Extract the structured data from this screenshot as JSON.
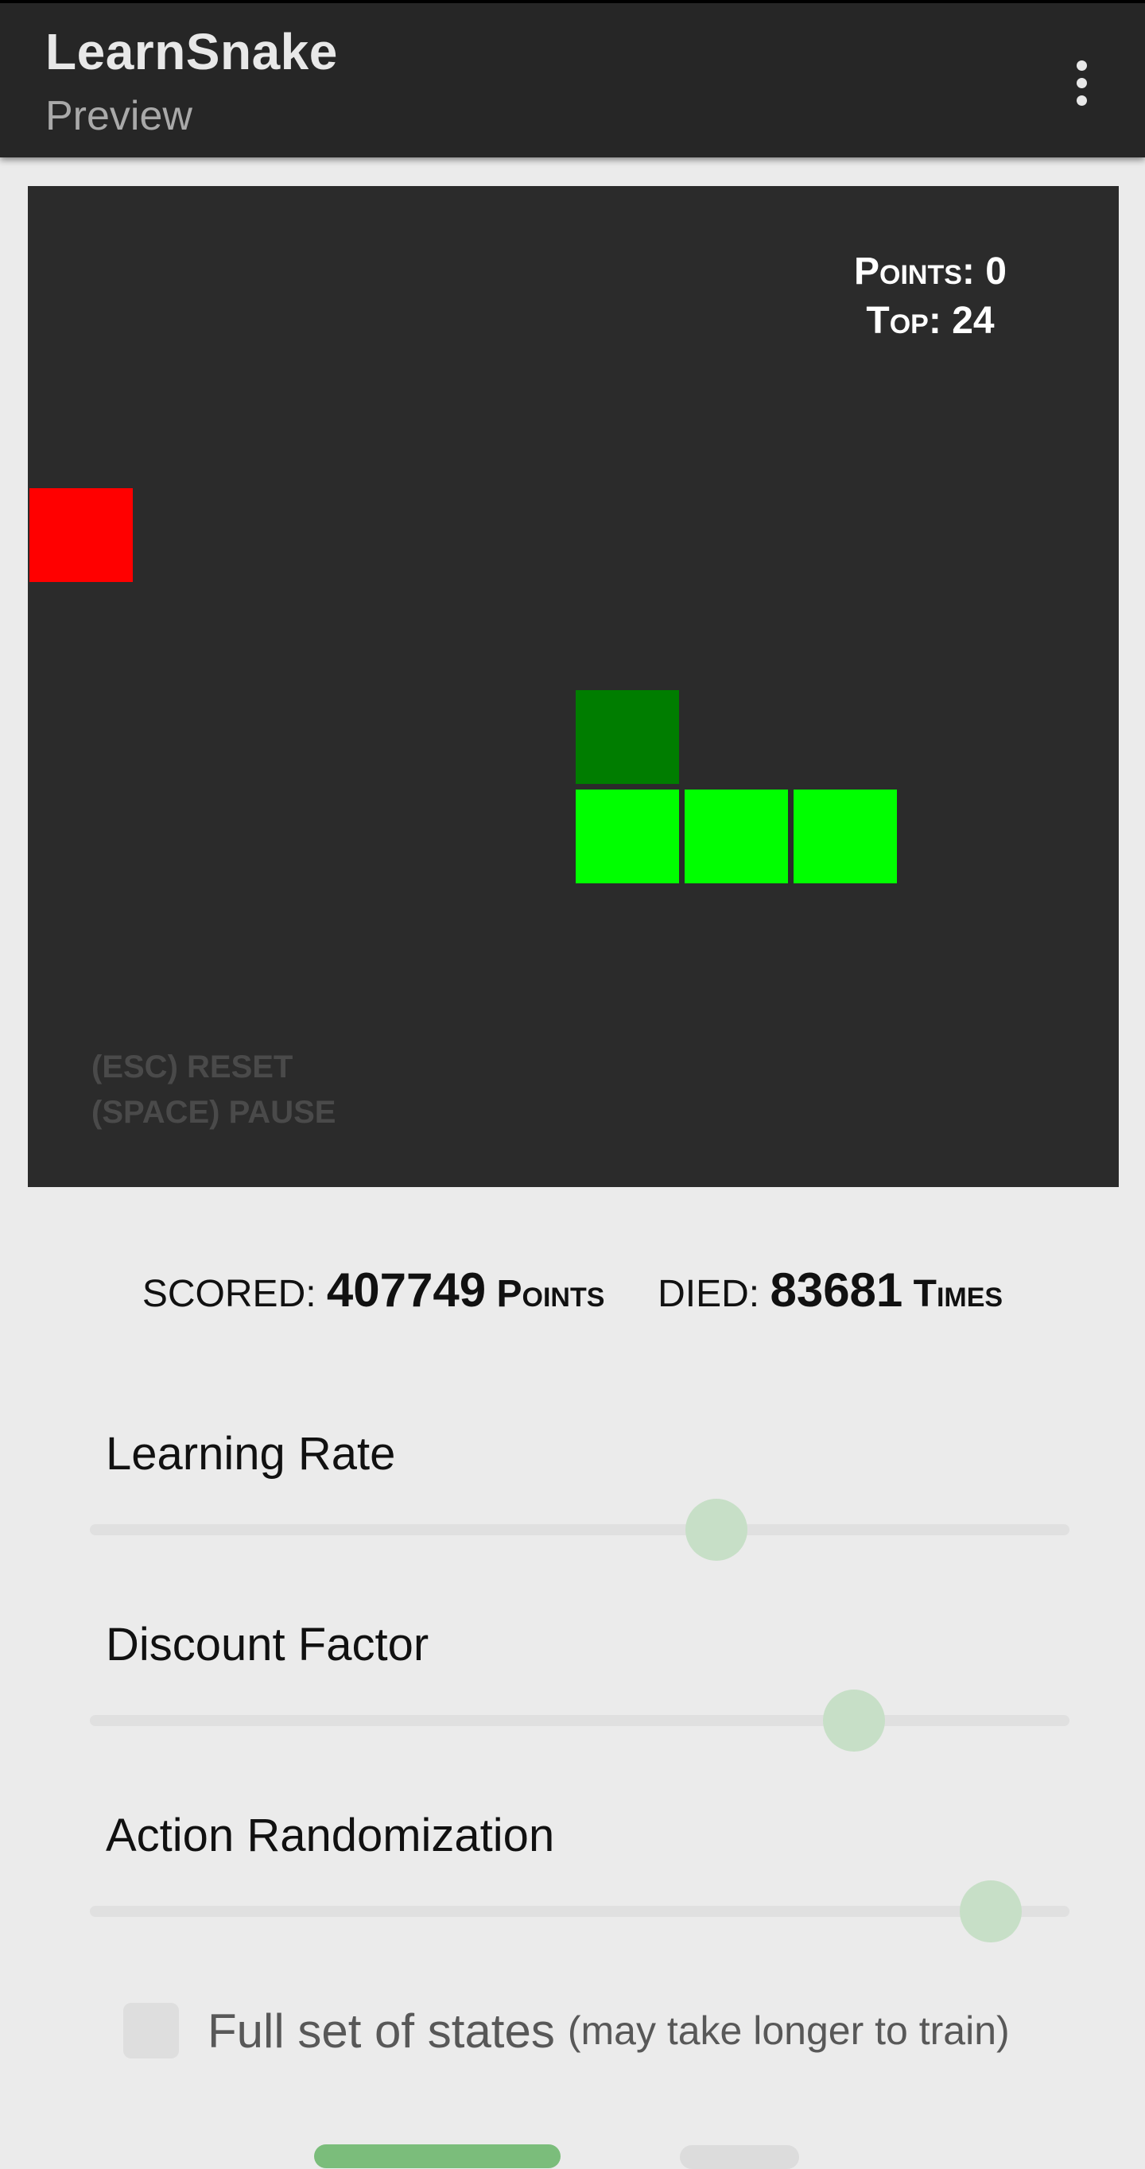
{
  "app": {
    "title": "LearnSnake",
    "subtitle": "Preview"
  },
  "menu": {
    "icon": "more-vert-icon"
  },
  "game": {
    "points_label": "Points:",
    "points_value": "0",
    "top_label": "Top:",
    "top_value": "24",
    "reset_hint": "(ESC) RESET",
    "pause_hint": "(SPACE) PAUSE",
    "colors": {
      "background": "#2b2b2b",
      "food": "#ff0000",
      "snake_head": "#007d00",
      "snake_body": "#00ff00"
    }
  },
  "stats": {
    "scored_label": "SCORED:",
    "scored_value": "407749",
    "scored_unit": "Points",
    "died_label": "DIED:",
    "died_value": "83681",
    "died_unit": "Times"
  },
  "sliders": [
    {
      "label": "Learning Rate",
      "value_fraction": 0.64
    },
    {
      "label": "Discount Factor",
      "value_fraction": 0.78
    },
    {
      "label": "Action Randomization",
      "value_fraction": 0.92
    }
  ],
  "options": {
    "full_states_label": "Full set of states",
    "full_states_note": "(may take longer to train)",
    "full_states_checked": false
  }
}
